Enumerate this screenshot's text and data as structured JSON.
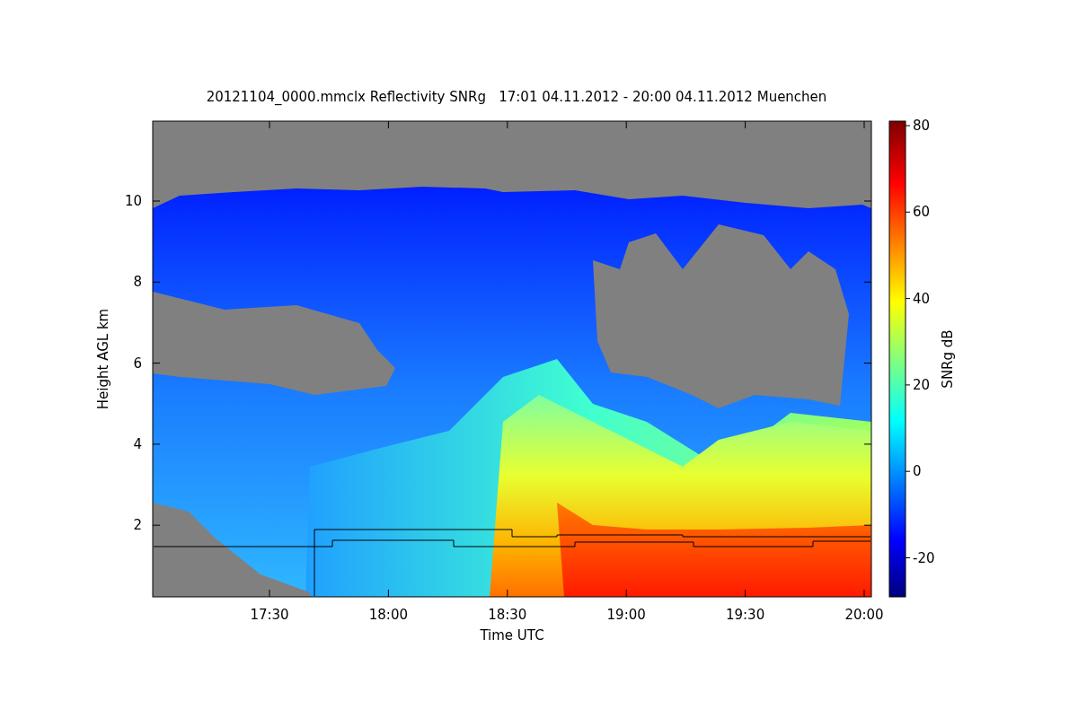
{
  "title": "20121104_0000.mmclx Reflectivity SNRg   17:01 04.11.2012 - 20:00 04.11.2012 Muenchen",
  "y_axis": {
    "label": "Height AGL km",
    "ticks": [
      "10",
      "8",
      "6",
      "4",
      "2"
    ]
  },
  "x_axis": {
    "label": "Time UTC",
    "ticks": [
      "17:30",
      "18:00",
      "18:30",
      "19:00",
      "19:30",
      "20:00"
    ]
  },
  "colorbar": {
    "label": "SNRg dB",
    "ticks": [
      "80",
      "60",
      "40",
      "20",
      "0",
      "-20"
    ]
  }
}
